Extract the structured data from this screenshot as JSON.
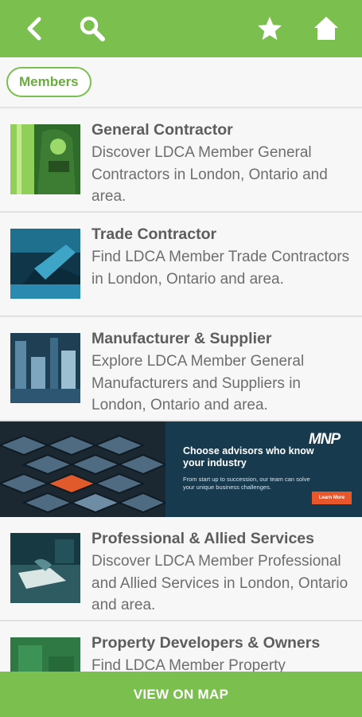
{
  "topbar": {
    "icons": [
      "back-arrow-icon",
      "search-icon",
      "star-icon",
      "home-icon"
    ],
    "color": "#7bbf4f"
  },
  "filter": {
    "chip_label": "Members"
  },
  "items": [
    {
      "title": "General Contractor",
      "desc": "Discover LDCA Member General Contractors in London, Ontario and area."
    },
    {
      "title": "Trade Contractor",
      "desc": "Find LDCA Member Trade Contractors in London, Ontario and area."
    },
    {
      "title": "Manufacturer & Supplier",
      "desc": "Explore LDCA Member General Manufacturers and Suppliers in London, Ontario and area."
    },
    {
      "title": "Professional & Allied Services",
      "desc": "Discover LDCA Member Professional and Allied Services in London, Ontario and area."
    },
    {
      "title": "Property Developers & Owners",
      "desc": "Find LDCA Member Property"
    }
  ],
  "ad": {
    "logo": "MNP",
    "headline": "Choose advisors who know your industry",
    "sub": "From start up to succession, our team can solve your unique business challenges.",
    "button": "Learn More"
  },
  "bottom": {
    "label": "VIEW ON MAP"
  }
}
